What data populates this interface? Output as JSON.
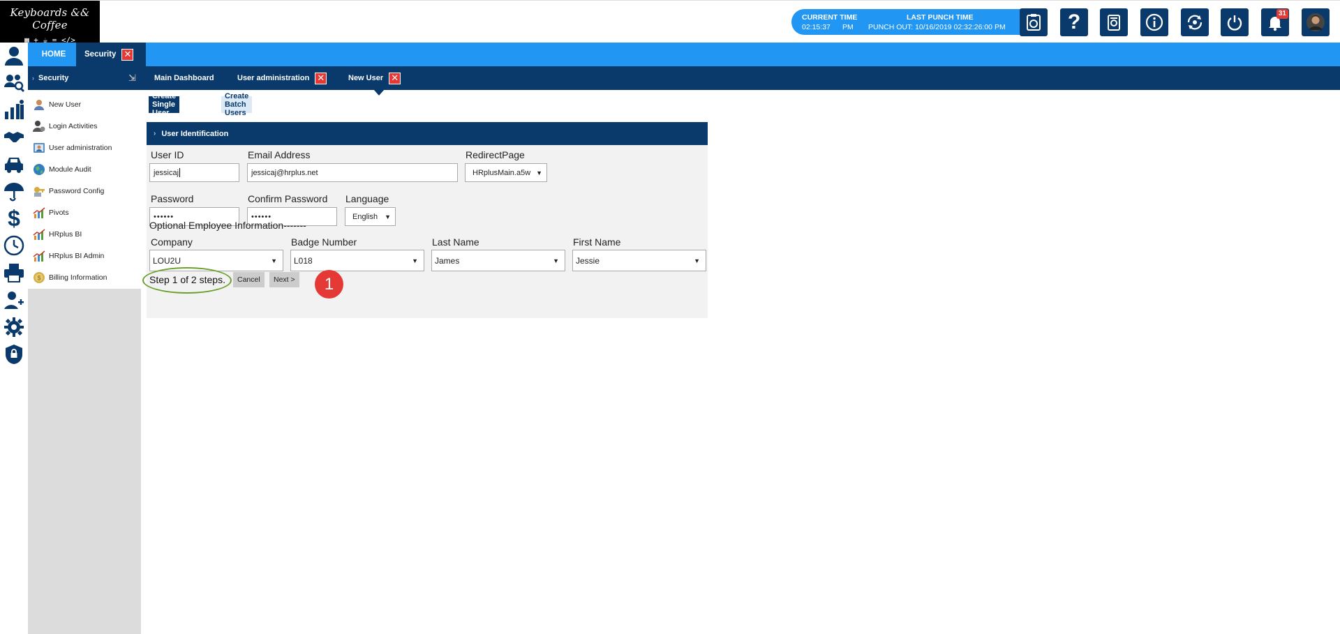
{
  "logo": {
    "title": "Keyboards && Coffee",
    "subtitle": "▦ + ☕ = </>"
  },
  "clock": {
    "current_label": "CURRENT TIME",
    "current_time": "02:15:37",
    "current_ampm": "PM",
    "last_label": "LAST PUNCH TIME",
    "last_value": "PUNCH OUT: 10/16/2019 02:32:26:00 PM"
  },
  "header_icons": [
    "timesheet-icon",
    "help-icon",
    "settings-doc-icon",
    "info-icon",
    "switch-icon",
    "power-icon",
    "bell-icon",
    "avatar"
  ],
  "notifications_count": "31",
  "tabs": [
    {
      "label": "HOME"
    },
    {
      "label": "Security"
    }
  ],
  "subbar": {
    "section": "Security",
    "items": [
      "Main Dashboard",
      "User administration",
      "New User"
    ]
  },
  "menu": {
    "items": [
      {
        "label": "New User",
        "icon": "user-add-icon"
      },
      {
        "label": "Login Activities",
        "icon": "login-icon"
      },
      {
        "label": "User administration",
        "icon": "id-card-icon"
      },
      {
        "label": "Module Audit",
        "icon": "globe-icon"
      },
      {
        "label": "Password Config",
        "icon": "key-icon"
      },
      {
        "label": "Pivots",
        "icon": "chart-icon"
      },
      {
        "label": "HRplus BI",
        "icon": "chart-icon"
      },
      {
        "label": "HRplus BI Admin",
        "icon": "chart-icon"
      },
      {
        "label": "Billing Information",
        "icon": "coin-icon"
      }
    ]
  },
  "content": {
    "tab_single": "Create Single User",
    "tab_batch": "Create Batch Users",
    "panel_title": "User Identification",
    "user_id_label": "User ID",
    "user_id_value": "jessicaj",
    "email_label": "Email Address",
    "email_value": "jessicaj@hrplus.net",
    "redirect_label": "RedirectPage",
    "redirect_value": "HRplusMain.a5w",
    "password_label": "Password",
    "password_value": "••••••",
    "confirm_label": "Confirm Password",
    "confirm_value": "••••••",
    "language_label": "Language",
    "language_value": "English",
    "optional_label": "Optional Employee Information-------",
    "company_label": "Company",
    "company_value": "LOU2U",
    "badge_label": "Badge Number",
    "badge_value": "L018",
    "last_label": "Last Name",
    "last_value": "James",
    "first_label": "First Name",
    "first_value": "Jessie",
    "step_text": "Step 1 of 2 steps.",
    "cancel": "Cancel",
    "next": "Next >",
    "callout_number": "1"
  },
  "colors": {
    "primary_dark": "#0a3a6b",
    "primary_light": "#2196f3",
    "close_red": "#e53935",
    "ring_green": "#6aa02c"
  }
}
